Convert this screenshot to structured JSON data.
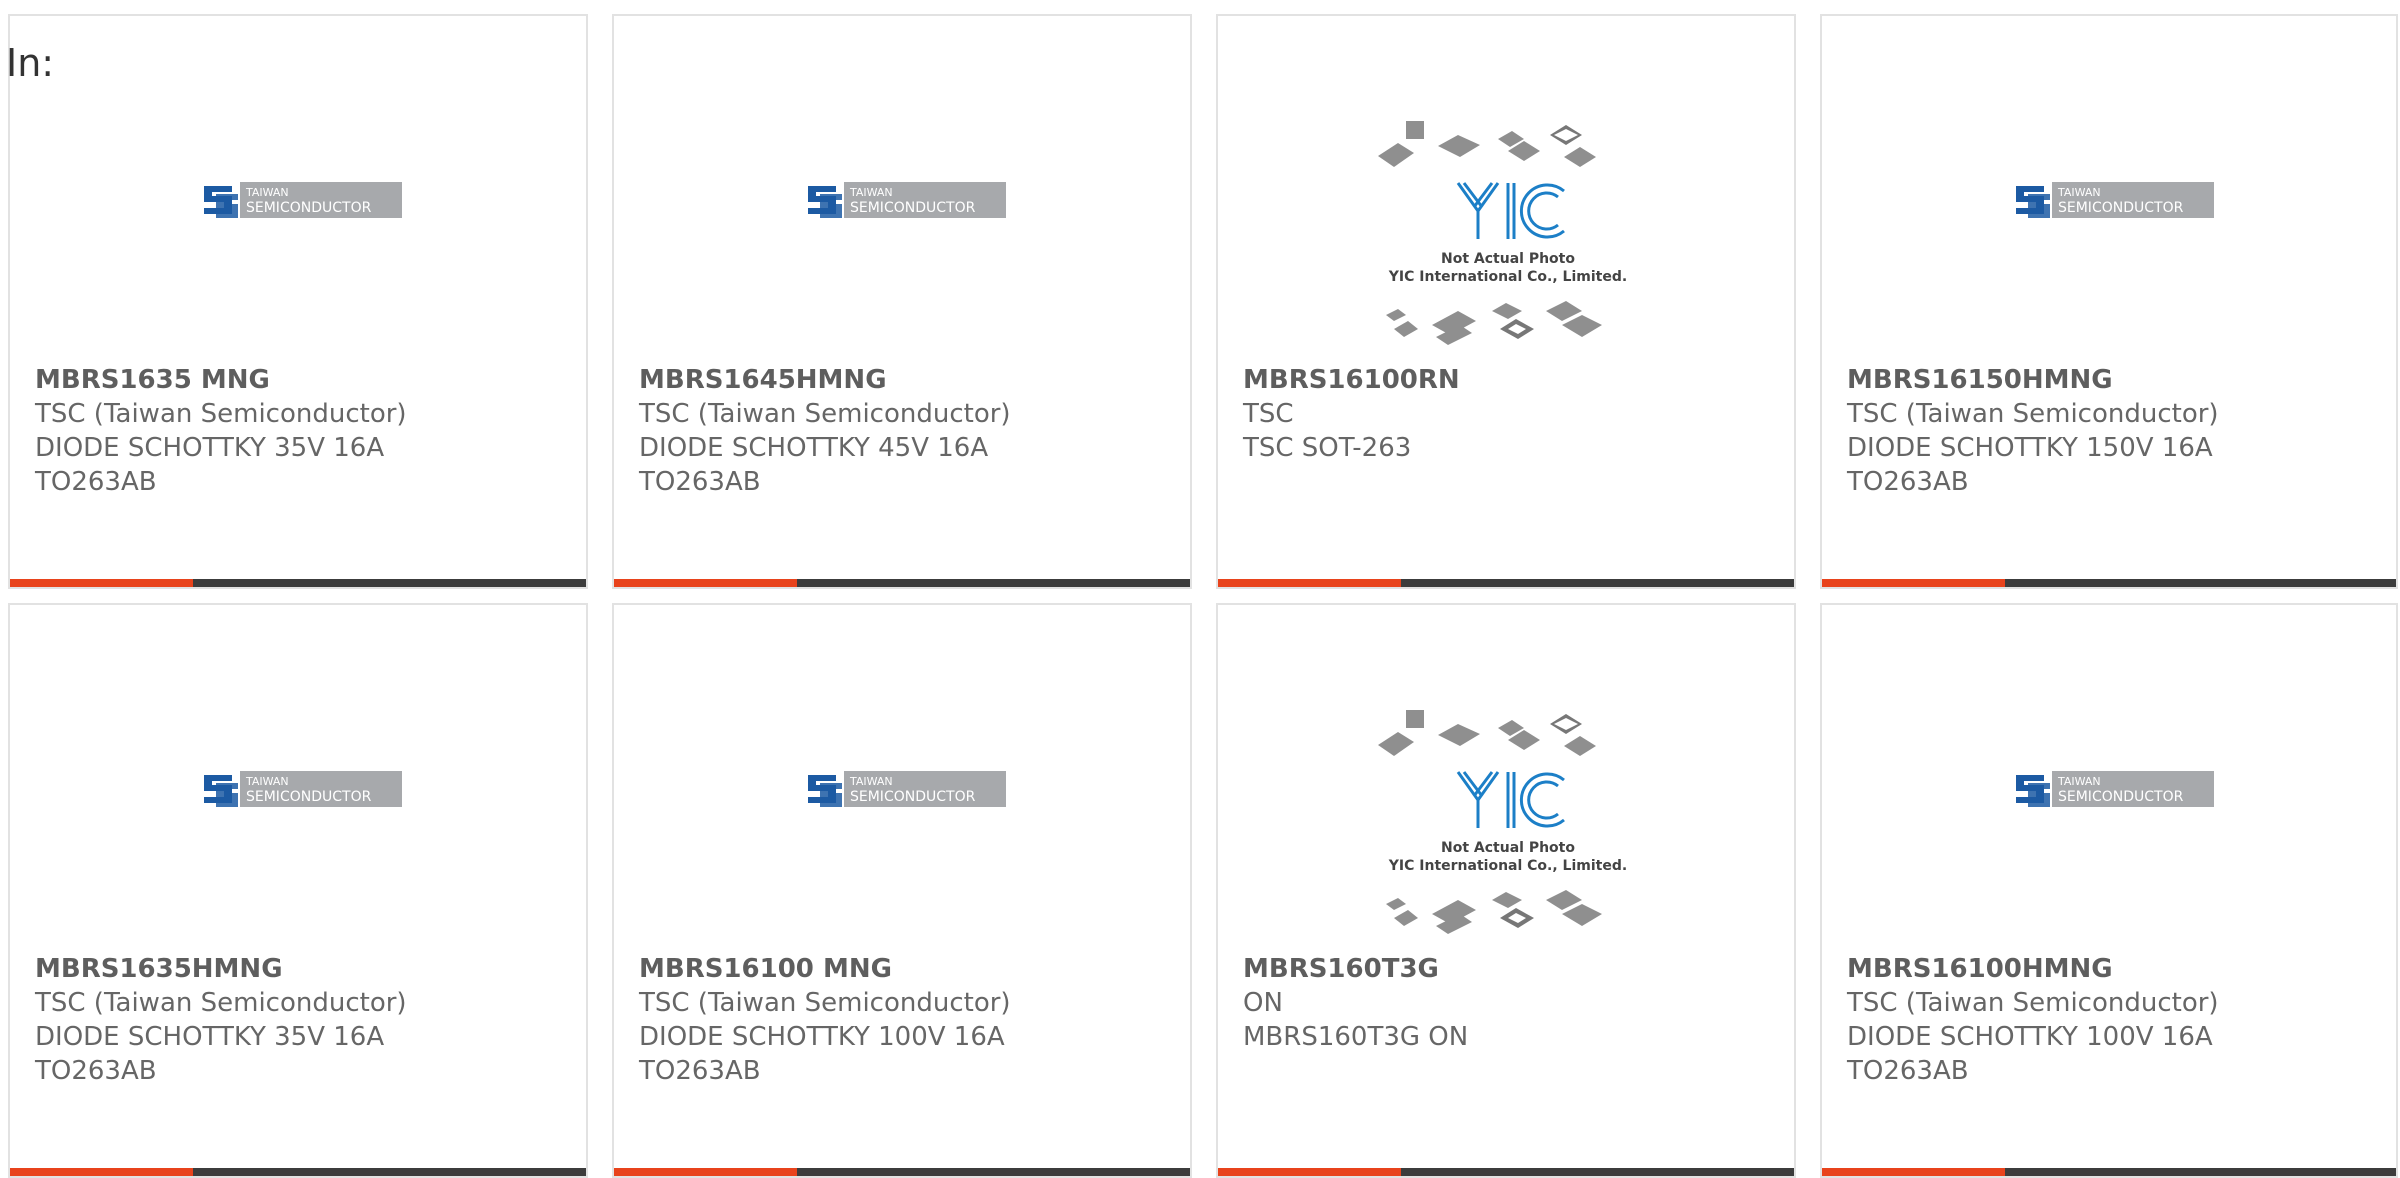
{
  "page": {
    "prefix": "In:",
    "accent_color": "#e8431c",
    "bar_color": "#3c3c3c"
  },
  "tsc_logo": {
    "line1": "TAIWAN",
    "line2": "SEMICONDUCTOR"
  },
  "yic_logo": {
    "mark": "YIC",
    "line1": "Not Actual Photo",
    "line2": "YIC International Co., Limited."
  },
  "products": [
    {
      "part": "MBRS1635 MNG",
      "maker": "TSC (Taiwan Semiconductor)",
      "desc": "DIODE SCHOTTKY 35V 16A",
      "pkg": "TO263AB",
      "image": "tsc"
    },
    {
      "part": "MBRS1645HMNG",
      "maker": "TSC (Taiwan Semiconductor)",
      "desc": "DIODE SCHOTTKY 45V 16A",
      "pkg": "TO263AB",
      "image": "tsc"
    },
    {
      "part": "MBRS16100RN",
      "maker": "TSC",
      "desc": "TSC SOT-263",
      "pkg": "",
      "image": "yic"
    },
    {
      "part": "MBRS16150HMNG",
      "maker": "TSC (Taiwan Semiconductor)",
      "desc": "DIODE SCHOTTKY 150V 16A",
      "pkg": "TO263AB",
      "image": "tsc"
    },
    {
      "part": "MBRS1635HMNG",
      "maker": "TSC (Taiwan Semiconductor)",
      "desc": "DIODE SCHOTTKY 35V 16A",
      "pkg": "TO263AB",
      "image": "tsc"
    },
    {
      "part": "MBRS16100 MNG",
      "maker": "TSC (Taiwan Semiconductor)",
      "desc": "DIODE SCHOTTKY 100V 16A",
      "pkg": "TO263AB",
      "image": "tsc"
    },
    {
      "part": "MBRS160T3G",
      "maker": "ON",
      "desc": "MBRS160T3G ON",
      "pkg": "",
      "image": "yic"
    },
    {
      "part": "MBRS16100HMNG",
      "maker": "TSC (Taiwan Semiconductor)",
      "desc": "DIODE SCHOTTKY 100V 16A",
      "pkg": "TO263AB",
      "image": "tsc"
    }
  ]
}
